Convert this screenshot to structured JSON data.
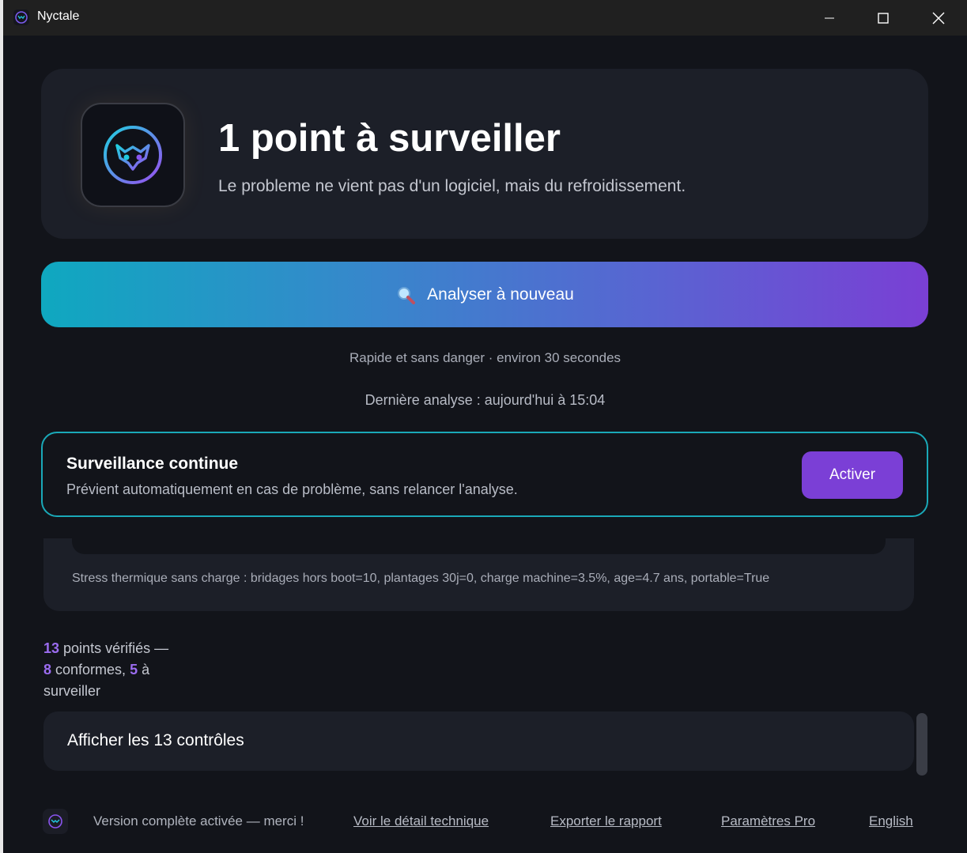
{
  "window": {
    "title": "Nyctale"
  },
  "hero": {
    "title": "1 point à surveiller",
    "subtitle": "Le probleme ne vient pas d'un logiciel, mais du refroidissement."
  },
  "scan": {
    "label": "Analyser à nouveau",
    "note": "Rapide et sans danger · environ 30 secondes",
    "last": "Dernière analyse : aujourd'hui à 15:04"
  },
  "watch": {
    "title": "Surveillance continue",
    "description": "Prévient automatiquement en cas de problème, sans relancer l'analyse.",
    "button": "Activer"
  },
  "detail": {
    "text": "Stress thermique sans charge : bridages hors boot=10, plantages 30j=0, charge machine=3.5%, age=4.7 ans, portable=True"
  },
  "summary": {
    "checked": "13",
    "checked_label": " points vérifiés —",
    "ok": "8",
    "ok_label": " conformes, ",
    "watch": "5",
    "watch_label": " à",
    "watch_label2": "surveiller"
  },
  "controls": {
    "label": "Afficher les 13 contrôles"
  },
  "footer": {
    "status": "Version complète activée — merci !",
    "tech": "Voir le détail technique",
    "export": "Exporter le rapport",
    "settings": "Paramètres Pro",
    "language": "English"
  },
  "colors": {
    "accent_cyan": "#1aa9b8",
    "accent_purple": "#7b3fd6",
    "number_purple": "#9b6cf0",
    "background": "#12141a",
    "card": "#1c1f28"
  }
}
